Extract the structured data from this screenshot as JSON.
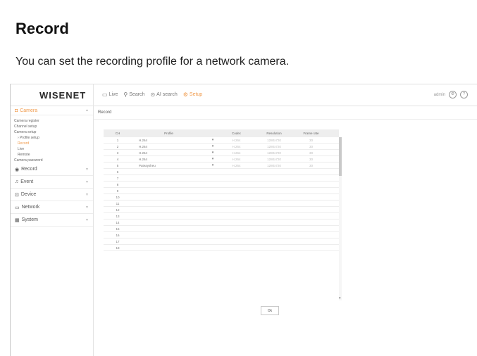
{
  "doc": {
    "title": "Record",
    "description": "You can set the recording profile for a network camera."
  },
  "app": {
    "logo": "WISENET",
    "nav": [
      {
        "label": "Live",
        "icon": "monitor-icon",
        "active": false
      },
      {
        "label": "Search",
        "icon": "search-icon",
        "active": false
      },
      {
        "label": "AI search",
        "icon": "ai-search-icon",
        "active": false
      },
      {
        "label": "Setup",
        "icon": "gear-icon",
        "active": true
      }
    ],
    "user": "admin",
    "accent_color": "#f09a4b"
  },
  "sidebar": {
    "camera": {
      "label": "Camera",
      "items": [
        "Camera register",
        "Channel setup",
        "Camera setup",
        "Profile setup",
        "Record",
        "Live",
        "Remote",
        "Camera password"
      ]
    },
    "sections": [
      "Record",
      "Event",
      "Device",
      "Network",
      "System"
    ]
  },
  "main": {
    "title": "Record",
    "ok_label": "Ok"
  },
  "table": {
    "headers": [
      "CH",
      "Profile",
      "Codec",
      "Resolution",
      "Frame rate"
    ],
    "rows": [
      {
        "ch": "1",
        "profile": "H.264",
        "codec": "H.264",
        "res": "1280x720",
        "fps": "30"
      },
      {
        "ch": "2",
        "profile": "H.264",
        "codec": "H.264",
        "res": "1280x720",
        "fps": "30"
      },
      {
        "ch": "3",
        "profile": "H.264",
        "codec": "H.264",
        "res": "1280x720",
        "fps": "30"
      },
      {
        "ch": "4",
        "profile": "H.264",
        "codec": "H.264",
        "res": "1280x720",
        "fps": "30"
      },
      {
        "ch": "5",
        "profile": "Pateaysheu",
        "codec": "H.264",
        "res": "1280x720",
        "fps": "30"
      },
      {
        "ch": "6",
        "profile": "",
        "codec": "",
        "res": "",
        "fps": ""
      },
      {
        "ch": "7",
        "profile": "",
        "codec": "",
        "res": "",
        "fps": ""
      },
      {
        "ch": "8",
        "profile": "",
        "codec": "",
        "res": "",
        "fps": ""
      },
      {
        "ch": "9",
        "profile": "",
        "codec": "",
        "res": "",
        "fps": ""
      },
      {
        "ch": "10",
        "profile": "",
        "codec": "",
        "res": "",
        "fps": ""
      },
      {
        "ch": "11",
        "profile": "",
        "codec": "",
        "res": "",
        "fps": ""
      },
      {
        "ch": "12",
        "profile": "",
        "codec": "",
        "res": "",
        "fps": ""
      },
      {
        "ch": "13",
        "profile": "",
        "codec": "",
        "res": "",
        "fps": ""
      },
      {
        "ch": "14",
        "profile": "",
        "codec": "",
        "res": "",
        "fps": ""
      },
      {
        "ch": "15",
        "profile": "",
        "codec": "",
        "res": "",
        "fps": ""
      },
      {
        "ch": "16",
        "profile": "",
        "codec": "",
        "res": "",
        "fps": ""
      },
      {
        "ch": "17",
        "profile": "",
        "codec": "",
        "res": "",
        "fps": ""
      },
      {
        "ch": "18",
        "profile": "",
        "codec": "",
        "res": "",
        "fps": ""
      }
    ]
  }
}
